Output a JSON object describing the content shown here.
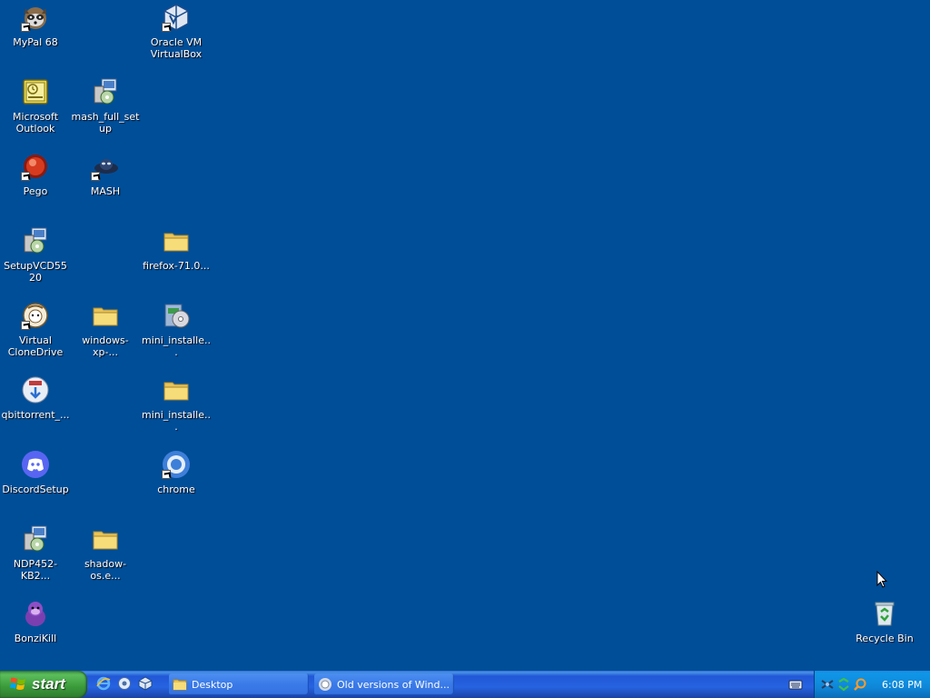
{
  "desktop": {
    "icons": [
      {
        "label": "MyPal 68"
      },
      {
        "label": "Oracle VM VirtualBox"
      },
      {
        "label": "Microsoft Outlook"
      },
      {
        "label": "mash_full_setup"
      },
      {
        "label": "Pego"
      },
      {
        "label": "MASH"
      },
      {
        "label": "SetupVCD5520"
      },
      {
        "label": "firefox-71.0..."
      },
      {
        "label": "Virtual CloneDrive"
      },
      {
        "label": "windows-xp-..."
      },
      {
        "label": "mini_installe..."
      },
      {
        "label": "qbittorrent_..."
      },
      {
        "label": "mini_installe..."
      },
      {
        "label": "DiscordSetup"
      },
      {
        "label": "chrome"
      },
      {
        "label": "NDP452-KB2..."
      },
      {
        "label": "shadow-os.e..."
      },
      {
        "label": "BonziKill"
      },
      {
        "label": "Recycle Bin"
      }
    ]
  },
  "taskbar": {
    "start_label": "start",
    "tasks": [
      {
        "label": "Desktop"
      },
      {
        "label": "Old versions of Wind..."
      }
    ],
    "clock": "6:08 PM"
  },
  "colors": {
    "desktop": "#004e98",
    "taskbar": "#2663e0",
    "start": "#3a9a3a",
    "tray": "#0f87d9"
  }
}
